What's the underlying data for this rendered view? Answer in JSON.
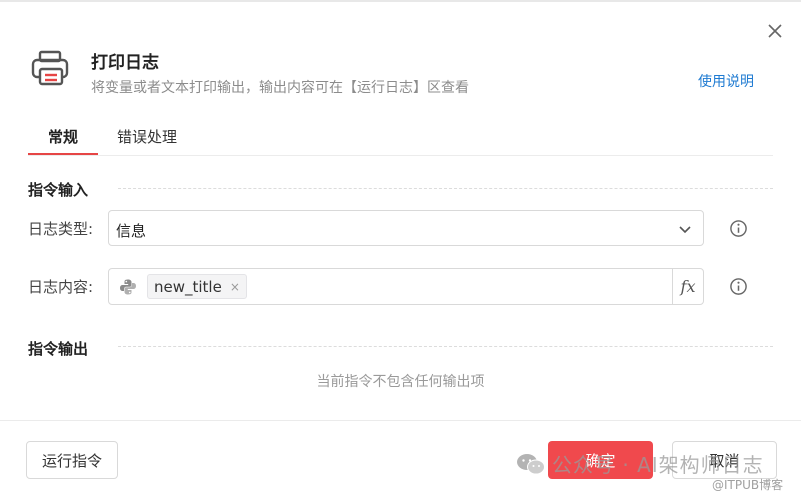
{
  "header": {
    "title": "打印日志",
    "subtitle": "将变量或者文本打印输出，输出内容可在【运行日志】区查看",
    "help_link": "使用说明"
  },
  "tabs": [
    {
      "label": "常规",
      "active": true
    },
    {
      "label": "错误处理",
      "active": false
    }
  ],
  "sections": {
    "input_title": "指令输入",
    "output_title": "指令输出",
    "output_empty": "当前指令不包含任何输出项"
  },
  "fields": {
    "log_type": {
      "label": "日志类型:",
      "value": "信息"
    },
    "log_content": {
      "label": "日志内容:",
      "tag": "new_title",
      "tag_remove": "×",
      "fx": "fx"
    }
  },
  "footer": {
    "run": "运行指令",
    "ok": "确定",
    "cancel": "取消"
  },
  "watermark": {
    "main": "公众号 · AI架构师日志",
    "sub": "@ITPUB博客"
  },
  "colors": {
    "accent": "#e64545",
    "primary_button": "#f0494d",
    "link": "#1f7bd2"
  },
  "icons": [
    "printer-icon",
    "close-icon",
    "chevron-down-icon",
    "python-icon",
    "info-icon",
    "wechat-icon"
  ]
}
